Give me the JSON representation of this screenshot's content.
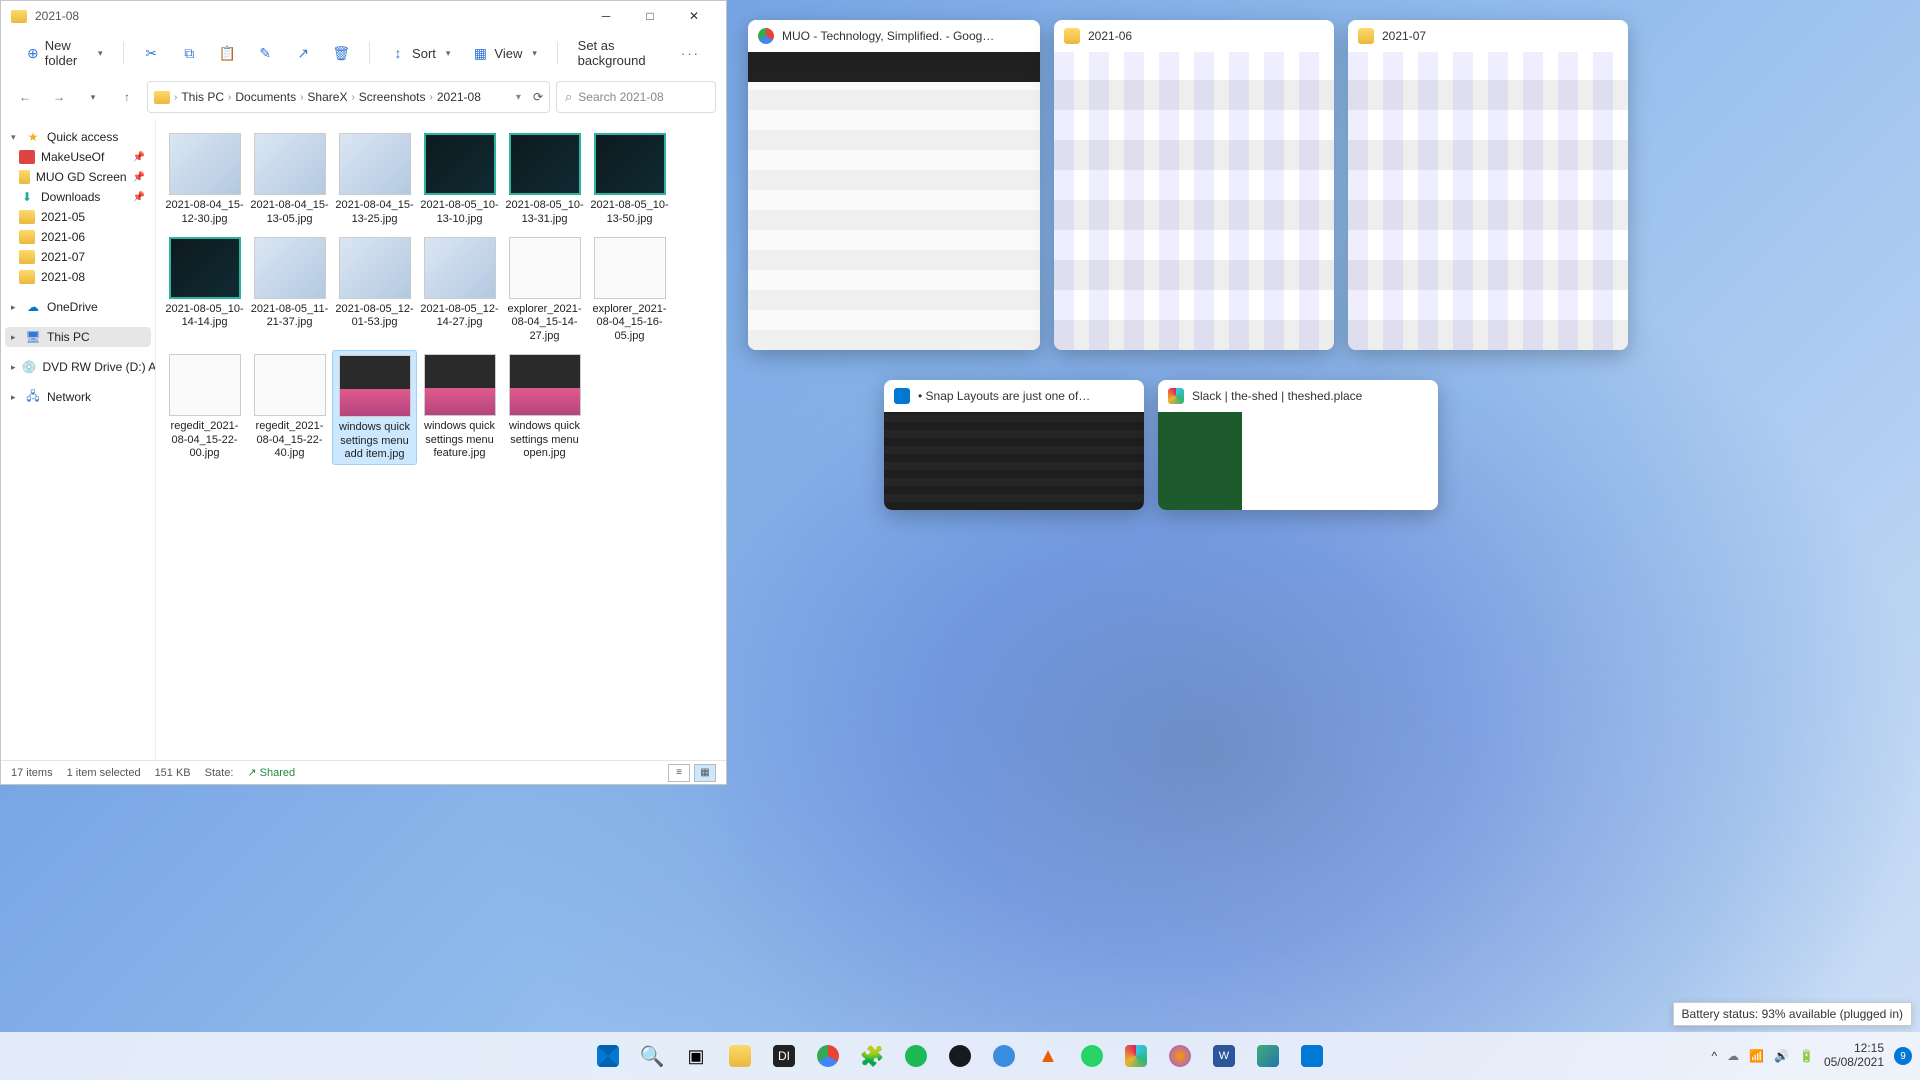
{
  "explorer": {
    "title": "2021-08",
    "toolbar": {
      "new": "New folder",
      "sort": "Sort",
      "view": "View",
      "bg": "Set as background"
    },
    "breadcrumb": [
      "This PC",
      "Documents",
      "ShareX",
      "Screenshots",
      "2021-08"
    ],
    "search_ph": "Search 2021-08",
    "nav": {
      "quick": "Quick access",
      "quick_items": [
        "MakeUseOf",
        "MUO GD Screen",
        "Downloads",
        "2021-05",
        "2021-06",
        "2021-07",
        "2021-08"
      ],
      "onedrive": "OneDrive",
      "thispc": "This PC",
      "dvd": "DVD RW Drive (D:) A",
      "network": "Network"
    },
    "files": [
      {
        "n": "2021-08-04_15-12-30.jpg",
        "t": "light"
      },
      {
        "n": "2021-08-04_15-13-05.jpg",
        "t": "light"
      },
      {
        "n": "2021-08-04_15-13-25.jpg",
        "t": "light"
      },
      {
        "n": "2021-08-05_10-13-10.jpg",
        "t": "dark"
      },
      {
        "n": "2021-08-05_10-13-31.jpg",
        "t": "dark"
      },
      {
        "n": "2021-08-05_10-13-50.jpg",
        "t": "dark"
      },
      {
        "n": "2021-08-05_10-14-14.jpg",
        "t": "dark"
      },
      {
        "n": "2021-08-05_11-21-37.jpg",
        "t": "light"
      },
      {
        "n": "2021-08-05_12-01-53.jpg",
        "t": "light"
      },
      {
        "n": "2021-08-05_12-14-27.jpg",
        "t": "light"
      },
      {
        "n": "explorer_2021-08-04_15-14-27.jpg",
        "t": "doc"
      },
      {
        "n": "explorer_2021-08-04_15-16-05.jpg",
        "t": "doc"
      },
      {
        "n": "regedit_2021-08-04_15-22-00.jpg",
        "t": "doc"
      },
      {
        "n": "regedit_2021-08-04_15-22-40.jpg",
        "t": "doc"
      },
      {
        "n": "windows quick settings menu add item.jpg",
        "t": "pink",
        "sel": true
      },
      {
        "n": "windows quick settings menu feature.jpg",
        "t": "pink"
      },
      {
        "n": "windows quick settings menu open.jpg",
        "t": "pink"
      }
    ],
    "status": {
      "items": "17 items",
      "sel": "1 item selected",
      "size": "151 KB",
      "state_label": "State:",
      "shared": "Shared"
    }
  },
  "snap": {
    "top": [
      {
        "title": "MUO - Technology, Simplified. - Goog…",
        "icon": "chrome",
        "body": "chrome"
      },
      {
        "title": "2021-06",
        "icon": "folder",
        "body": "expl"
      },
      {
        "title": "2021-07",
        "icon": "folder",
        "body": "expl"
      }
    ],
    "bottom": [
      {
        "title": "• Snap Layouts are just one of…",
        "icon": "vscode",
        "body": "vscode"
      },
      {
        "title": "Slack | the-shed | theshed.place",
        "icon": "slack",
        "body": "slack"
      }
    ]
  },
  "battery_tip": "Battery status: 93% available (plugged in)",
  "tray": {
    "time": "12:15",
    "date": "05/08/2021",
    "notif": "9"
  }
}
